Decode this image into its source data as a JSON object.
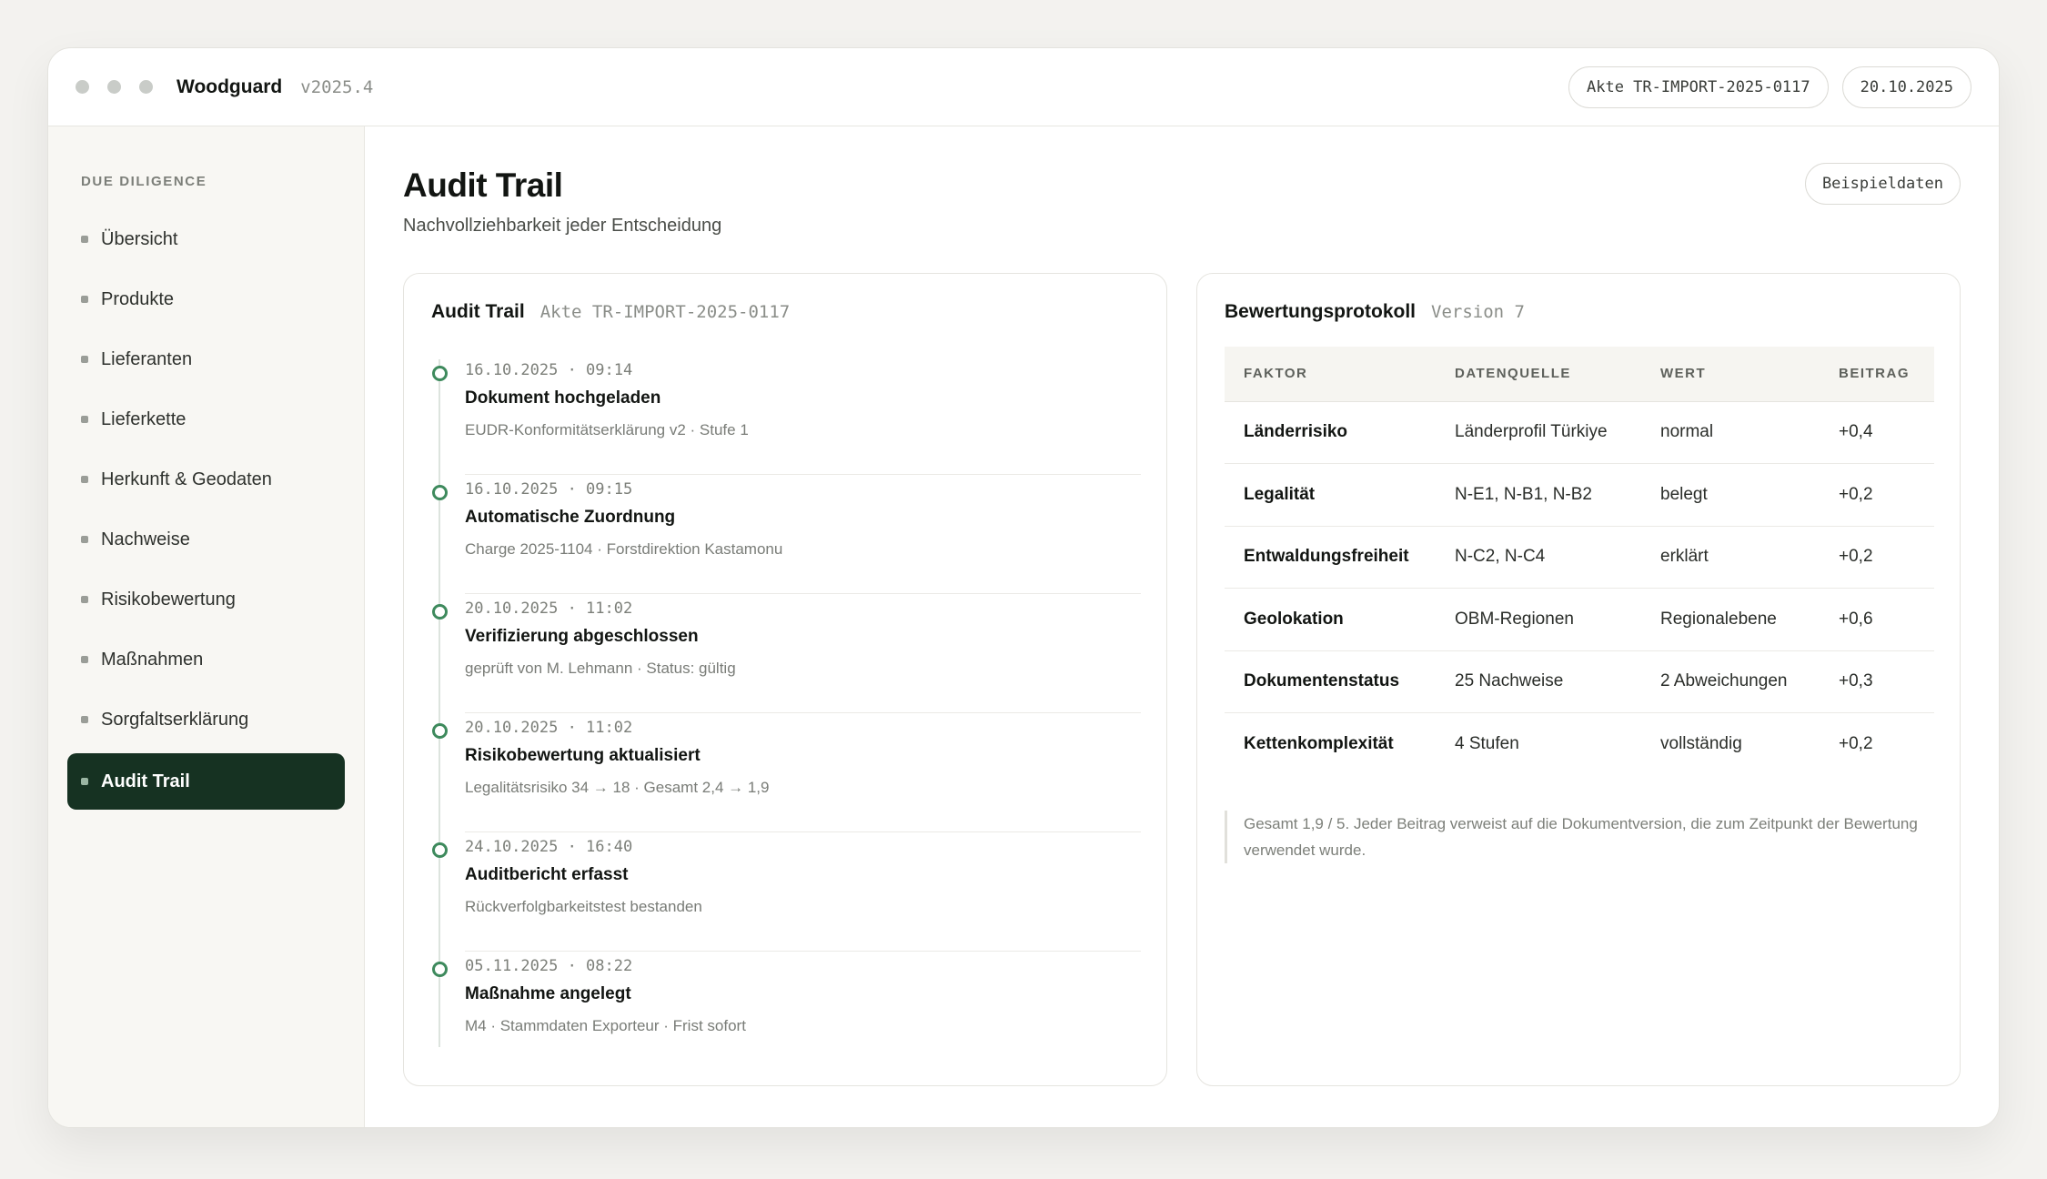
{
  "app": {
    "name": "Woodguard",
    "version": "v2025.4",
    "case_chip": "Akte TR-IMPORT-2025-0117",
    "date_chip": "20.10.2025"
  },
  "sidebar": {
    "section": "DUE DILIGENCE",
    "items": [
      {
        "label": "Übersicht"
      },
      {
        "label": "Produkte"
      },
      {
        "label": "Lieferanten"
      },
      {
        "label": "Lieferkette"
      },
      {
        "label": "Herkunft & Geodaten"
      },
      {
        "label": "Nachweise"
      },
      {
        "label": "Risikobewertung"
      },
      {
        "label": "Maßnahmen"
      },
      {
        "label": "Sorgfaltserklärung"
      },
      {
        "label": "Audit Trail",
        "active": true
      }
    ]
  },
  "page": {
    "title": "Audit Trail",
    "subtitle": "Nachvollziehbarkeit jeder Entscheidung",
    "sample_button": "Beispieldaten"
  },
  "audit": {
    "title": "Audit Trail",
    "meta": "Akte TR-IMPORT-2025-0117",
    "events": [
      {
        "time": "16.10.2025 · 09:14",
        "title": "Dokument hochgeladen",
        "detail": "EUDR-Konformitätserklärung v2 · Stufe 1"
      },
      {
        "time": "16.10.2025 · 09:15",
        "title": "Automatische Zuordnung",
        "detail": "Charge 2025-1104 · Forstdirektion Kastamonu"
      },
      {
        "time": "20.10.2025 · 11:02",
        "title": "Verifizierung abgeschlossen",
        "detail": "geprüft von M. Lehmann · Status: gültig"
      },
      {
        "time": "20.10.2025 · 11:02",
        "title": "Risikobewertung aktualisiert",
        "detail": "Legalitätsrisiko 34 → 18 · Gesamt 2,4 → 1,9"
      },
      {
        "time": "24.10.2025 · 16:40",
        "title": "Auditbericht erfasst",
        "detail": "Rückverfolgbarkeitstest bestanden"
      },
      {
        "time": "05.11.2025 · 08:22",
        "title": "Maßnahme angelegt",
        "detail": "M4 · Stammdaten Exporteur · Frist sofort"
      }
    ]
  },
  "protocol": {
    "title": "Bewertungsprotokoll",
    "meta": "Version 7",
    "headers": {
      "factor": "FAKTOR",
      "source": "DATENQUELLE",
      "value": "WERT",
      "contribution": "BEITRAG"
    },
    "rows": [
      {
        "factor": "Länderrisiko",
        "source": "Länderprofil Türkiye",
        "value": "normal",
        "contribution": "+0,4"
      },
      {
        "factor": "Legalität",
        "source": "N-E1, N-B1, N-B2",
        "value": "belegt",
        "contribution": "+0,2"
      },
      {
        "factor": "Entwaldungsfreiheit",
        "source": "N-C2, N-C4",
        "value": "erklärt",
        "contribution": "+0,2"
      },
      {
        "factor": "Geolokation",
        "source": "OBM-Regionen",
        "value": "Regionalebene",
        "contribution": "+0,6"
      },
      {
        "factor": "Dokumentenstatus",
        "source": "25 Nachweise",
        "value": "2 Abweichungen",
        "contribution": "+0,3"
      },
      {
        "factor": "Kettenkomplexität",
        "source": "4 Stufen",
        "value": "vollständig",
        "contribution": "+0,2"
      }
    ],
    "note": "Gesamt 1,9 / 5. Jeder Beitrag verweist auf die Dokumentversion, die zum Zeitpunkt der Bewertung verwendet wurde."
  }
}
